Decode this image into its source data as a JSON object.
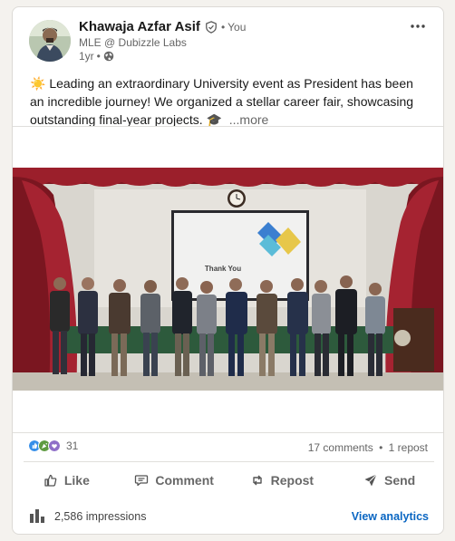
{
  "post": {
    "author": {
      "name": "Khawaja Azfar Asif",
      "you_label": "You",
      "separator": "•",
      "headline": "MLE @ Dubizzle Labs",
      "time": "1yr",
      "time_separator": "•",
      "visibility_icon": "globe-icon",
      "verified_icon": "verified-shield-icon"
    },
    "text": "☀️ Leading an extraordinary University event as President has been an incredible journey! We organized a stellar career fair, showcasing outstanding final-year projects. 🎓",
    "see_more": "...more",
    "media": {
      "slide_text": "Thank You",
      "icon": "group-photo"
    }
  },
  "social": {
    "reaction_count": "31",
    "reaction_icons": [
      "like-icon",
      "celebrate-icon",
      "love-icon"
    ],
    "comments": "17 comments",
    "separator": "•",
    "reposts": "1 repost"
  },
  "actions": [
    {
      "label": "Like",
      "icon": "thumbs-up-icon"
    },
    {
      "label": "Comment",
      "icon": "comment-icon"
    },
    {
      "label": "Repost",
      "icon": "repost-icon"
    },
    {
      "label": "Send",
      "icon": "send-icon"
    }
  ],
  "analytics": {
    "impressions": "2,586 impressions",
    "link": "View analytics",
    "icon": "bar-chart-icon"
  },
  "colors": {
    "link_blue": "#0a66c2",
    "muted": "#666666",
    "background": "#f4f2ee"
  }
}
